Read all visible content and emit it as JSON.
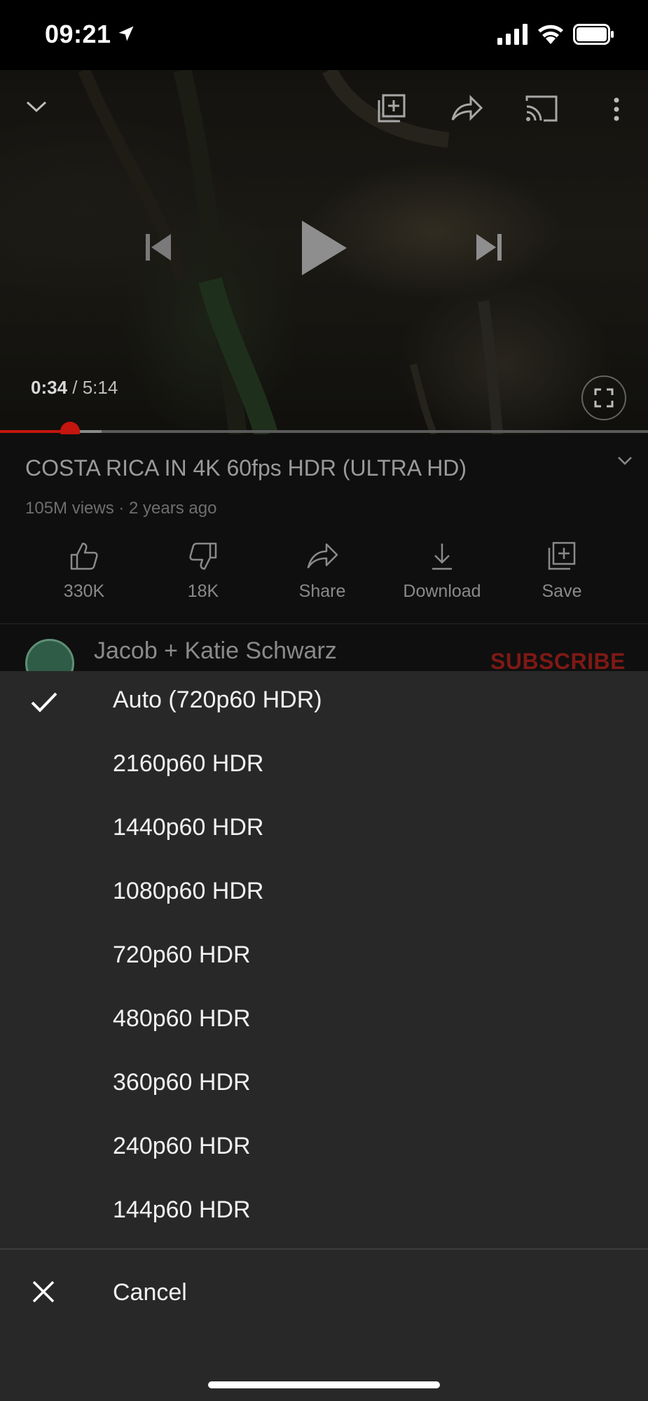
{
  "status_bar": {
    "time": "09:21"
  },
  "player": {
    "current_time": "0:34",
    "separator": " / ",
    "duration": "5:14",
    "progress_fraction": 0.108,
    "buffer_fraction": 0.157,
    "accent_color": "#c4150f"
  },
  "video": {
    "title": "COSTA RICA IN 4K 60fps HDR (ULTRA HD)",
    "meta": "105M views · 2 years ago"
  },
  "actions": [
    {
      "label": "330K",
      "icon": "thumbs-up-icon"
    },
    {
      "label": "18K",
      "icon": "thumbs-down-icon"
    },
    {
      "label": "Share",
      "icon": "share-icon"
    },
    {
      "label": "Download",
      "icon": "download-icon"
    },
    {
      "label": "Save",
      "icon": "save-to-playlist-icon"
    }
  ],
  "channel": {
    "name": "Jacob + Katie Schwarz",
    "subscribe_label": "SUBSCRIBE"
  },
  "quality_sheet": {
    "options": [
      "Auto (720p60 HDR)",
      "2160p60 HDR",
      "1440p60 HDR",
      "1080p60 HDR",
      "720p60 HDR",
      "480p60 HDR",
      "360p60 HDR",
      "240p60 HDR",
      "144p60 HDR"
    ],
    "selected_index": 0,
    "cancel_label": "Cancel"
  }
}
